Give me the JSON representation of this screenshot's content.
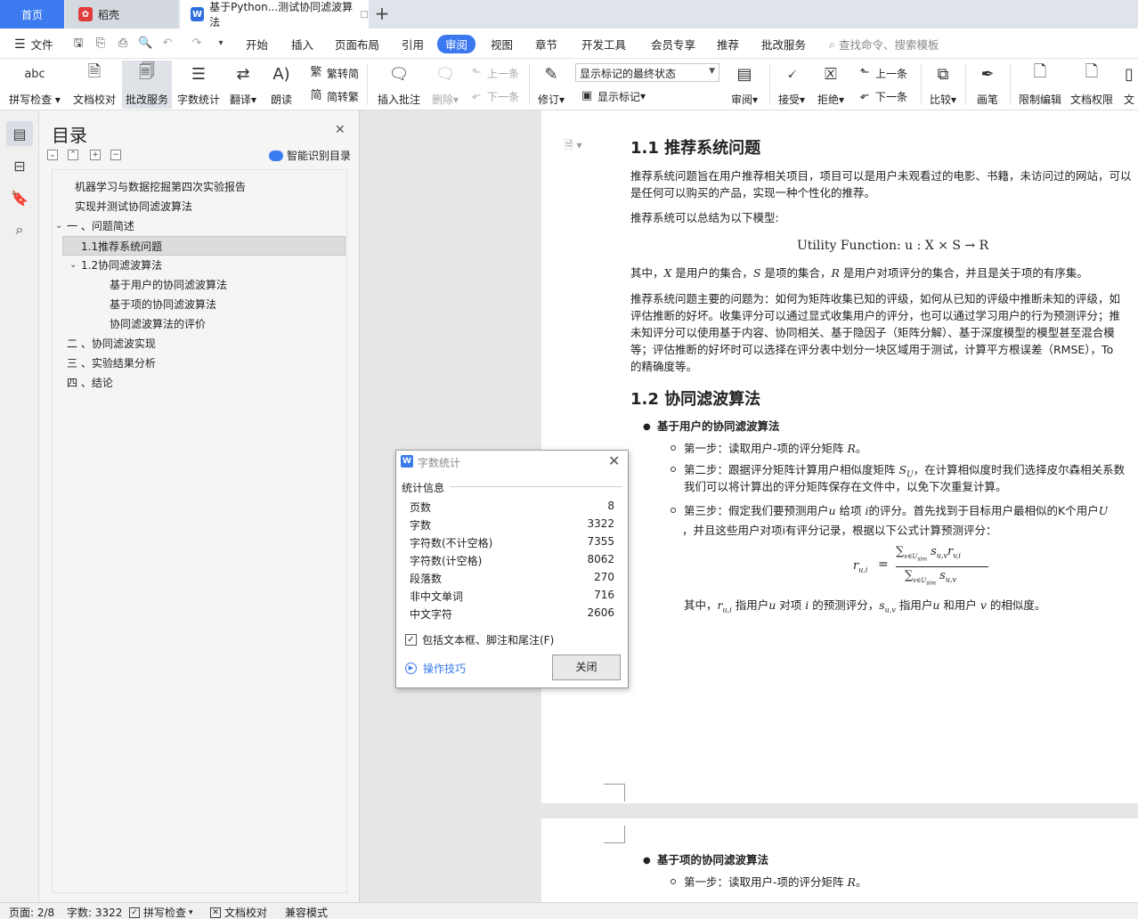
{
  "tabs": {
    "home": "首页",
    "daoke": "稻壳",
    "document": "基于Python...测试协同滤波算法",
    "add": "+"
  },
  "menu": {
    "file": "文件",
    "items": [
      "开始",
      "插入",
      "页面布局",
      "引用",
      "审阅",
      "视图",
      "章节",
      "开发工具",
      "会员专享",
      "推荐",
      "批改服务"
    ],
    "active": "审阅",
    "search_placeholder": "查找命令、搜索模板"
  },
  "ribbon": {
    "spell_check": "拼写检查",
    "doc_proof": "文档校对",
    "correction_service": "批改服务",
    "word_count": "字数统计",
    "translate": "翻译",
    "read_aloud": "朗读",
    "to_traditional": "繁转简",
    "to_simplified": "简转繁",
    "insert_comment": "插入批注",
    "delete": "删除",
    "prev_comment": "上一条",
    "next_comment": "下一条",
    "track_changes": "修订",
    "markup_select": "显示标记的最终状态",
    "show_markup": "显示标记",
    "review": "审阅",
    "accept": "接受",
    "reject": "拒绝",
    "prev_change": "上一条",
    "next_change": "下一条",
    "compare": "比较",
    "pen": "画笔",
    "restrict_edit": "限制编辑",
    "doc_permission": "文档权限",
    "doc_cut": "文"
  },
  "icons": {
    "abc": "abc"
  },
  "toc": {
    "title": "目录",
    "smart_label": "智能识别目录",
    "items": [
      "机器学习与数据挖掘第四次实验报告",
      "实现并测试协同滤波算法",
      "一 、问题简述",
      "1.1推荐系统问题",
      "1.2协同滤波算法",
      "基于用户的协同滤波算法",
      "基于项的协同滤波算法",
      "协同滤波算法的评价",
      "二 、协同滤波实现",
      "三 、实验结果分析",
      "四 、结论"
    ]
  },
  "doc": {
    "h_1_1": "1.1 推荐系统问题",
    "p1_l1": "推荐系统问题旨在用户推荐相关项目，项目可以是用户未观看过的电影、书籍，未访问过的网站，可以",
    "p1_l2": "是任何可以购买的产品，实现一种个性化的推荐。",
    "p2": "推荐系统可以总结为以下模型:",
    "formula1": "Utility Function: u : X × S → R",
    "p3_a": "其中，",
    "p3_x": "X",
    "p3_b": " 是用户的集合，",
    "p3_s": "S",
    "p3_c": " 是项的集合，",
    "p3_r": "R",
    "p3_d": " 是用户对项评分的集合，并且是关于项的有序集。",
    "p4_l1": "推荐系统问题主要的问题为：如何为矩阵收集已知的评级，如何从已知的评级中推断未知的评级，如",
    "p4_l2": "评估推断的好坏。收集评分可以通过显式收集用户的评分，也可以通过学习用户的行为预测评分；推",
    "p4_l3": "未知评分可以使用基于内容、协同相关、基于隐因子（矩阵分解）、基于深度模型的模型甚至混合模",
    "p4_l4": "等；评估推断的好坏时可以选择在评分表中划分一块区域用于测试，计算平方根误差（RMSE），To",
    "p4_l5": "的精确度等。",
    "h_1_2": "1.2 协同滤波算法",
    "b1": "基于用户的协同滤波算法",
    "s1_a": "第一步：读取用户-项的评分矩阵",
    "s1_r": "R",
    "s1_b": "。",
    "s2_l1a": "第二步：跟据评分矩阵计算用户相似度矩阵",
    "s2_su": "S",
    "s2_l1b": "，在计算相似度时我们选择皮尔森相关系数",
    "s2_l2": "我们可以将计算出的评分矩阵保存在文件中，以免下次重复计算。",
    "s3_l1a": "第三步：假定我们要预测用户",
    "s3_u": "u",
    "s3_l1b": " 给项 ",
    "s3_i": "i",
    "s3_l1c": "的评分。首先找到于目标用户最相似的K个用户",
    "s3_U": "U",
    "s3_l2": "，并且这些用户对项i有评分记录，根据以下公式计算预测评分：",
    "formula2_lhs": "r",
    "formula2_lhs_sub": "u,i",
    "formula2_eq": "=",
    "formula2_num": "∑",
    "formula2_num_sub": "v∈U",
    "formula2_num_subsub": "sim",
    "formula2_num_s": "s",
    "formula2_num_s_sub": "u,v",
    "formula2_num_r": "r",
    "formula2_num_r_sub": "v,i",
    "formula2_den": "∑",
    "formula2_den_sub": "v∈U",
    "formula2_den_subsub": "sim",
    "formula2_den_s": "s",
    "formula2_den_s_sub": "u,v",
    "s3_note_a": "其中，",
    "s3_note_r": "r",
    "s3_note_rsub": "u,i",
    "s3_note_b": " 指用户",
    "s3_note_u": "u",
    "s3_note_c": " 对项 ",
    "s3_note_i": "i",
    "s3_note_d": " 的预测评分，",
    "s3_note_s": "s",
    "s3_note_ssub": "u,v",
    "s3_note_e": " 指用户",
    "s3_note_u2": "u",
    "s3_note_f": " 和用户 ",
    "s3_note_v": "v",
    "s3_note_g": " 的相似度。",
    "b2": "基于项的协同滤波算法",
    "p2s1_a": "第一步：读取用户-项的评分矩阵",
    "p2s1_r": "R",
    "p2s1_b": "。"
  },
  "dialog": {
    "title": "字数统计",
    "section": "统计信息",
    "stats": [
      {
        "label": "页数",
        "value": "8"
      },
      {
        "label": "字数",
        "value": "3322"
      },
      {
        "label": "字符数(不计空格)",
        "value": "7355"
      },
      {
        "label": "字符数(计空格)",
        "value": "8062"
      },
      {
        "label": "段落数",
        "value": "270"
      },
      {
        "label": "非中文单词",
        "value": "716"
      },
      {
        "label": "中文字符",
        "value": "2606"
      }
    ],
    "include_label": "包括文本框、脚注和尾注(F)",
    "include_checked": "✓",
    "tips": "操作技巧",
    "close_button": "关闭"
  },
  "status": {
    "page": "页面: 2/8",
    "words": "字数: 3322",
    "spell": "拼写检查",
    "proof": "文档校对",
    "compat": "兼容模式"
  }
}
